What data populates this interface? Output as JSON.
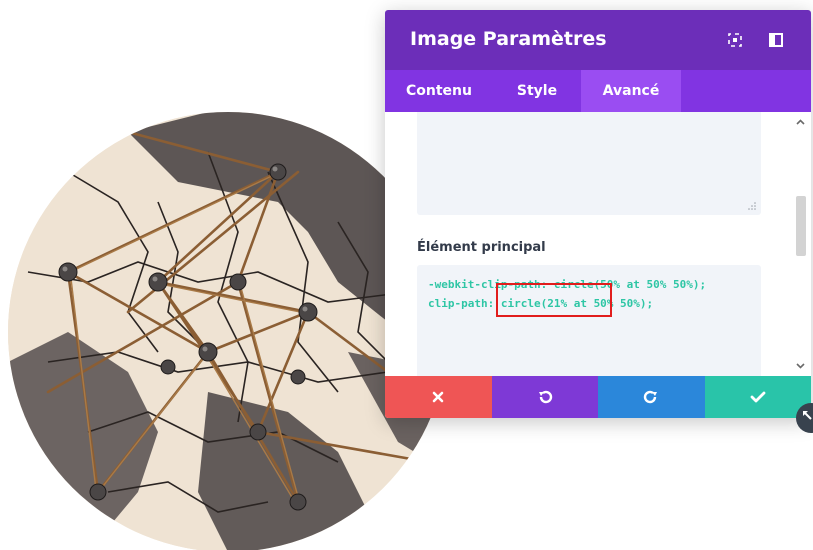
{
  "modal": {
    "title": "Image Paramètres",
    "header_icons": [
      "expand-icon",
      "sidebar-layout-icon"
    ]
  },
  "tabs": [
    {
      "label": "Contenu",
      "active": false
    },
    {
      "label": "Style",
      "active": false
    },
    {
      "label": "Avancé",
      "active": true
    }
  ],
  "field": {
    "label": "Élément principal",
    "code_lines": [
      "-webkit-clip-path: circle(50% at 50% 50%);",
      "clip-path: circle(21% at 50% 50%);"
    ]
  },
  "footer": {
    "buttons": [
      "close-icon",
      "undo-icon",
      "redo-icon",
      "check-icon"
    ]
  },
  "colors": {
    "header": "#6c2eb9",
    "tabs": "#8134e2",
    "active_tab": "#9a4df2",
    "code": "#2ec6a5",
    "cancel": "#ef5555",
    "undo": "#7e39d6",
    "redo": "#2b87da",
    "save": "#29c4a9",
    "highlight": "#e11d1d"
  },
  "image": {
    "description_icon": "map-with-pins-and-string-image"
  }
}
